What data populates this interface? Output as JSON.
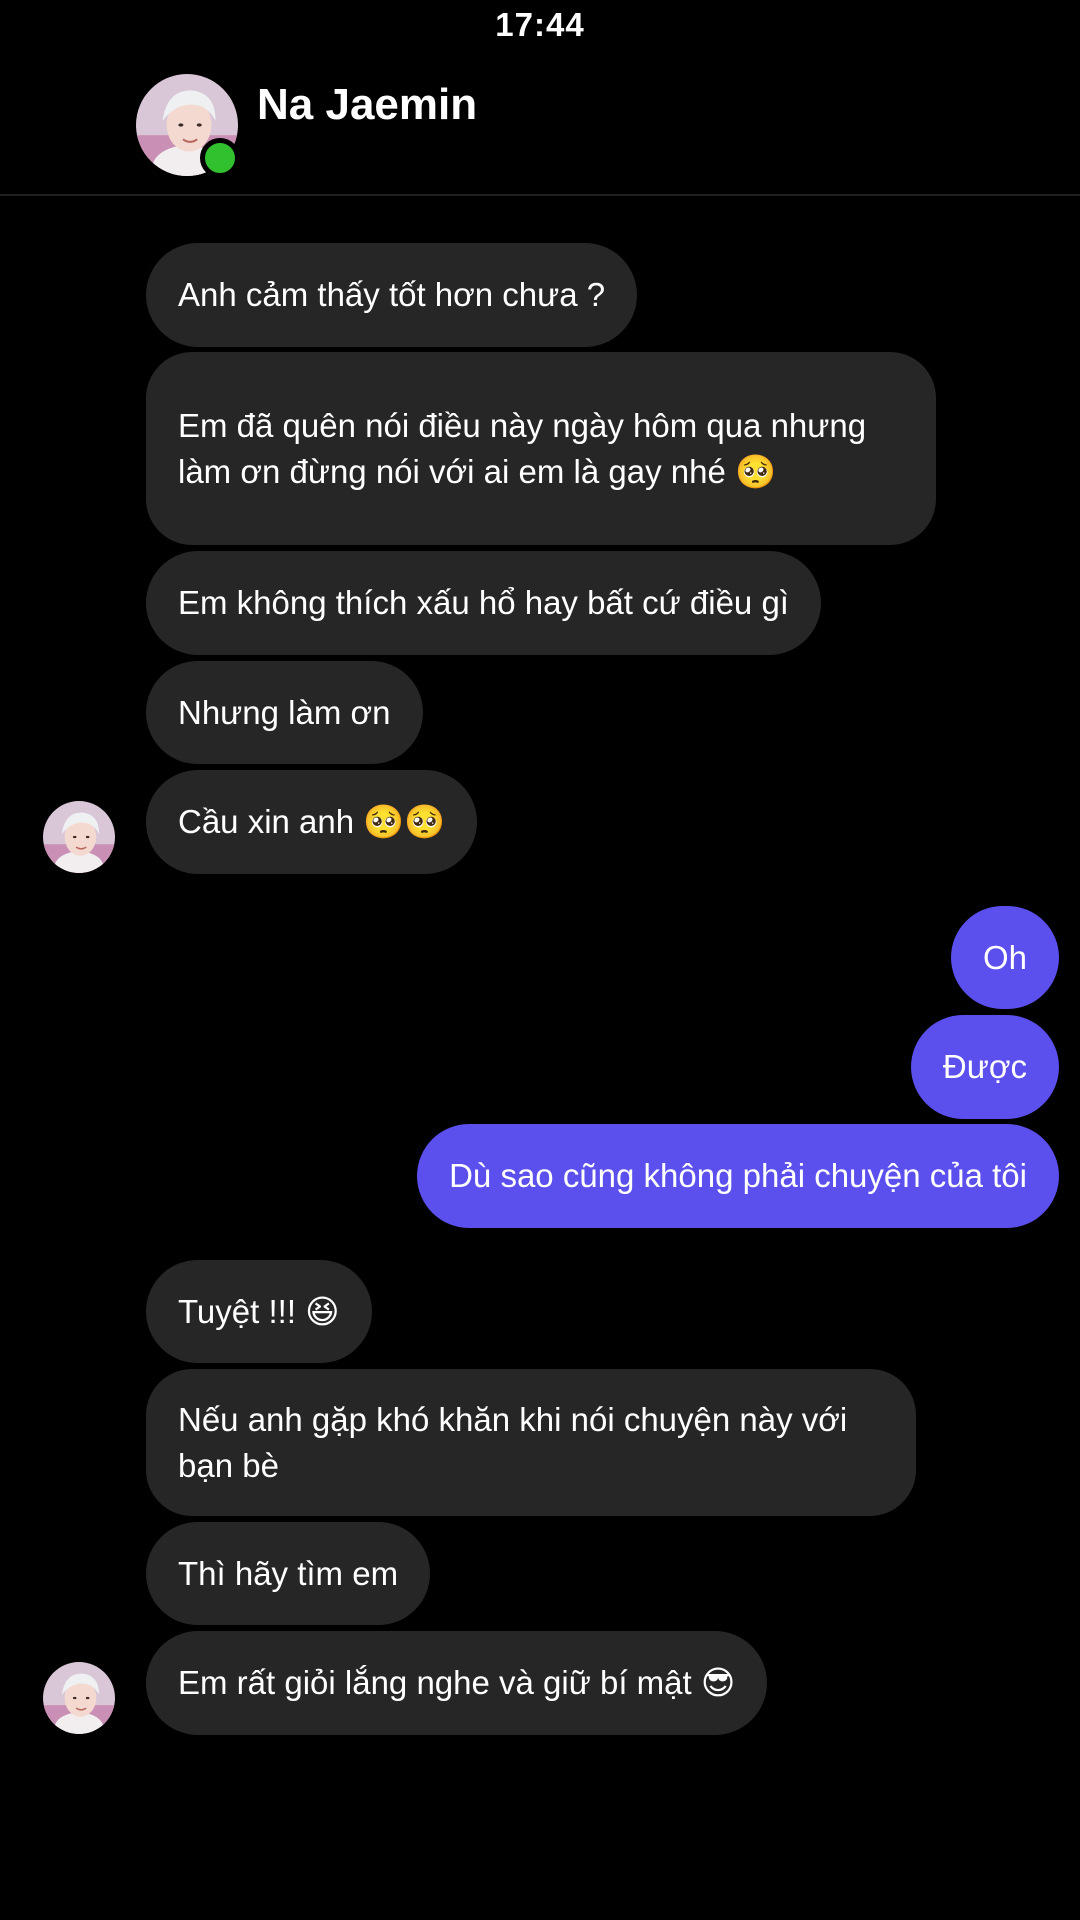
{
  "status_bar": {
    "time": "17:44"
  },
  "header": {
    "contact_name": "Na Jaemin",
    "online": true
  },
  "colors": {
    "background": "#000000",
    "incoming_bubble": "#262626",
    "outgoing_bubble": "#5b4fee",
    "online_indicator": "#31c12f"
  },
  "messages": [
    {
      "direction": "incoming",
      "text": "Anh cảm thấy tốt hơn chưa ?"
    },
    {
      "direction": "incoming",
      "text": "Em đã quên nói điều này ngày hôm qua nhưng làm ơn đừng nói với ai em là gay nhé 🥺"
    },
    {
      "direction": "incoming",
      "text": "Em không thích xấu hổ hay bất cứ điều gì"
    },
    {
      "direction": "incoming",
      "text": "Nhưng làm ơn"
    },
    {
      "direction": "incoming",
      "text": "Cầu xin anh 🥺🥺"
    },
    {
      "direction": "outgoing",
      "text": "Oh"
    },
    {
      "direction": "outgoing",
      "text": "Được"
    },
    {
      "direction": "outgoing",
      "text": "Dù sao cũng không phải chuyện của tôi"
    },
    {
      "direction": "incoming",
      "text": "Tuyệt !!! 😆"
    },
    {
      "direction": "incoming",
      "text": "Nếu anh gặp khó khăn khi nói chuyện này với bạn bè"
    },
    {
      "direction": "incoming",
      "text": "Thì hãy tìm em"
    },
    {
      "direction": "incoming",
      "text": "Em rất giỏi lắng nghe và giữ bí mật 😎"
    }
  ]
}
